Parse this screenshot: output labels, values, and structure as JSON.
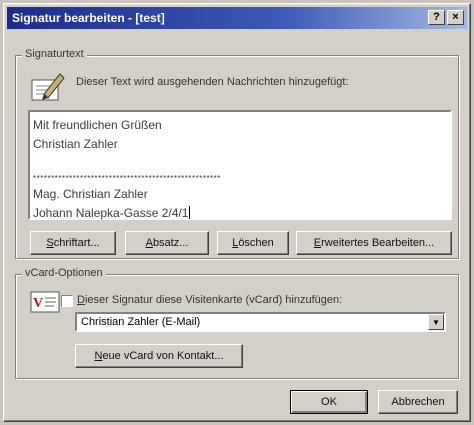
{
  "window": {
    "title": "Signatur bearbeiten - [test]",
    "help_button": "?",
    "close_button": "×"
  },
  "signature_group": {
    "label": "Signaturtext",
    "description": "Dieser Text wird ausgehenden Nachrichten hinzugefügt:",
    "lines": [
      "Mit freundlichen Grüßen",
      "Christian Zahler",
      "",
      "****************************************************",
      "Mag. Christian Zahler",
      "Johann Nalepka-Gasse 2/4/1"
    ],
    "buttons": {
      "font": {
        "mnemonic": "S",
        "rest": "chriftart..."
      },
      "paragraph": {
        "mnemonic": "A",
        "rest": "bsatz..."
      },
      "clear": {
        "mnemonic": "L",
        "rest": "öschen"
      },
      "advanced": {
        "mnemonic": "E",
        "rest": "rweitertes Bearbeiten..."
      }
    }
  },
  "vcard_group": {
    "label": "vCard-Optionen",
    "checkbox_mnemonic": "D",
    "checkbox_label_rest": "ieser Signatur diese Visitenkarte (vCard) hinzufügen:",
    "selected_vcard": "Christian Zahler (E-Mail)",
    "new_vcard": {
      "mnemonic": "N",
      "rest": "eue vCard von Kontakt..."
    }
  },
  "footer": {
    "ok_label": "OK",
    "cancel_label": "Abbrechen"
  }
}
